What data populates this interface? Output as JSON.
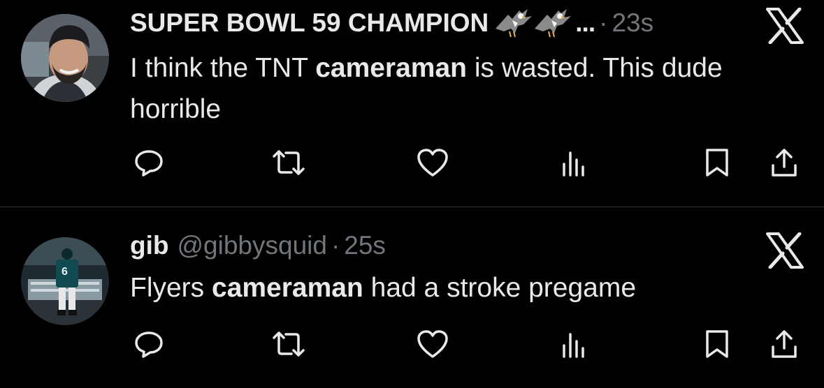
{
  "tweets": [
    {
      "name": "SUPER BOWL 59 CHAMPION",
      "handle": "",
      "badges": [
        "eagle-emoji",
        "eagle-emoji"
      ],
      "ellipsis": "...",
      "separator": "·",
      "time": "23s",
      "text_parts": [
        {
          "text": "I think the TNT ",
          "bold": false
        },
        {
          "text": "cameraman",
          "bold": true
        },
        {
          "text": " is wasted. This dude horrible",
          "bold": false
        }
      ],
      "avatar": "man-in-beanie-avatar"
    },
    {
      "name": "gib",
      "handle": "@gibbysquid",
      "separator": "·",
      "time": "25s",
      "text_parts": [
        {
          "text": "Flyers ",
          "bold": false
        },
        {
          "text": "cameraman",
          "bold": true
        },
        {
          "text": " had a stroke pregame",
          "bold": false
        }
      ],
      "avatar": "football-player-tunnel-avatar"
    }
  ],
  "actions": [
    "reply-icon",
    "retweet-icon",
    "like-icon",
    "views-icon",
    "bookmark-icon",
    "share-icon"
  ],
  "colors": {
    "background": "#000000",
    "text": "#e7e9ea",
    "secondary": "#71767b",
    "divider": "#2f3336"
  }
}
